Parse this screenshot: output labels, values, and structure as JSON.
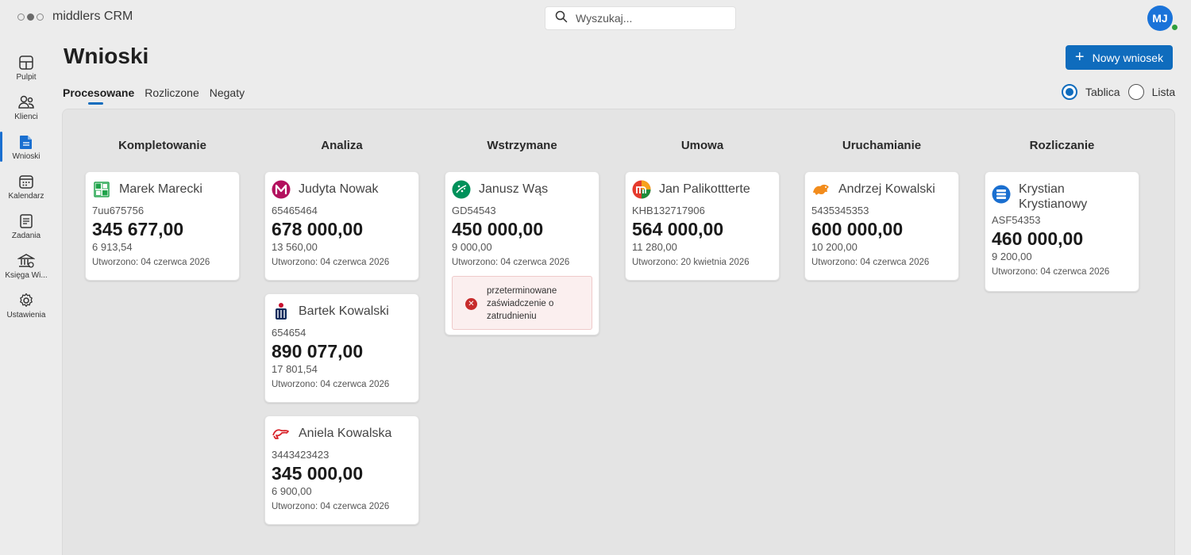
{
  "app": {
    "title": "middlers CRM"
  },
  "search": {
    "placeholder": "Wyszukaj..."
  },
  "user": {
    "initials": "MJ",
    "presence": "online"
  },
  "sidebar": {
    "items": [
      {
        "label": "Pulpit",
        "icon": "dashboard-icon"
      },
      {
        "label": "Klienci",
        "icon": "people-icon"
      },
      {
        "label": "Wnioski",
        "icon": "document-icon",
        "active": true
      },
      {
        "label": "Kalendarz",
        "icon": "calendar-icon"
      },
      {
        "label": "Zadania",
        "icon": "tasks-icon"
      },
      {
        "label": "Księga Wi...",
        "icon": "bank-building-icon"
      },
      {
        "label": "Ustawienia",
        "icon": "gear-icon"
      }
    ]
  },
  "page": {
    "title": "Wnioski",
    "new_button": "Nowy wniosek",
    "tabs": [
      "Procesowane",
      "Rozliczone",
      "Negaty"
    ],
    "active_tab": "Procesowane",
    "view": {
      "options": [
        "Tablica",
        "Lista"
      ],
      "selected": "Tablica"
    }
  },
  "board": {
    "columns": [
      {
        "title": "Kompletowanie",
        "cards": [
          {
            "name": "Marek Marecki",
            "id": "7uu675756",
            "amount": "345 677,00",
            "fee": "6 913,54",
            "created": "Utworzono: 04 czerwca 2026",
            "bank": "velo-bank-logo"
          }
        ]
      },
      {
        "title": "Analiza",
        "cards": [
          {
            "name": "Judyta Nowak",
            "id": "65465464",
            "amount": "678 000,00",
            "fee": "13 560,00",
            "created": "Utworzono: 04 czerwca 2026",
            "bank": "millennium-bank-logo"
          },
          {
            "name": "Bartek Kowalski",
            "id": "654654",
            "amount": "890 077,00",
            "fee": "17 801,54",
            "created": "Utworzono: 04 czerwca 2026",
            "bank": "pko-bank-logo"
          },
          {
            "name": "Aniela Kowalska",
            "id": "3443423423",
            "amount": "345 000,00",
            "fee": "6 900,00",
            "created": "Utworzono: 04 czerwca 2026",
            "bank": "pekao-bank-logo"
          }
        ]
      },
      {
        "title": "Wstrzymane",
        "cards": [
          {
            "name": "Janusz Wąs",
            "id": "GD54543",
            "amount": "450 000,00",
            "fee": "9 000,00",
            "created": "Utworzono: 04 czerwca 2026",
            "bank": "bnp-bank-logo",
            "alert": "przeterminowane zaświadczenie o zatrudnieniu"
          }
        ]
      },
      {
        "title": "Umowa",
        "cards": [
          {
            "name": "Jan Palikottterte",
            "id": "KHB132717906",
            "amount": "564 000,00",
            "fee": "11 280,00",
            "created": "Utworzono: 20 kwietnia 2026",
            "bank": "mbank-logo"
          }
        ]
      },
      {
        "title": "Uruchamianie",
        "cards": [
          {
            "name": "Andrzej Kowalski",
            "id": "5435345353",
            "amount": "600 000,00",
            "fee": "10 200,00",
            "created": "Utworzono: 04 czerwca 2026",
            "bank": "alior-bank-logo"
          }
        ]
      },
      {
        "title": "Rozliczanie",
        "cards": [
          {
            "name": "Krystian Krystianowy",
            "id": "ASF54353",
            "amount": "460 000,00",
            "fee": "9 200,00",
            "created": "Utworzono: 04 czerwca 2026",
            "bank": "santander-bank-logo"
          }
        ]
      }
    ]
  },
  "colors": {
    "accent": "#0f6cbd",
    "alert_bg": "#fbefef",
    "alert_icon": "#c72b2b",
    "avatar": "#1a73d9",
    "presence": "#2e9e3e"
  }
}
